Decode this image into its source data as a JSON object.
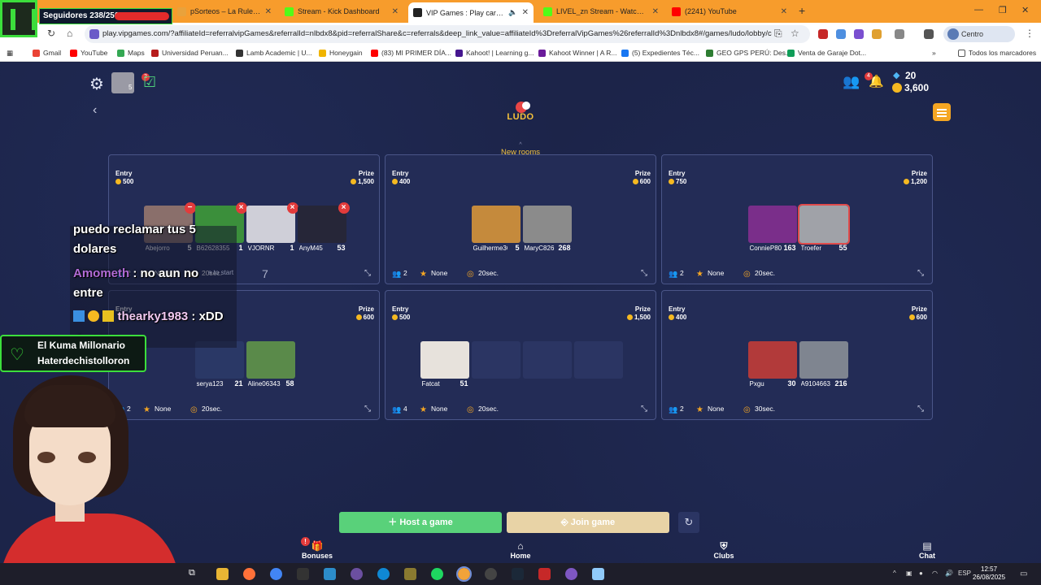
{
  "browser": {
    "tabs": [
      {
        "label": "pSorteos – La Ruleta de la S",
        "favicon_color": "#e9a23b"
      },
      {
        "label": "Stream - Kick Dashboard",
        "favicon_color": "#53fc18"
      },
      {
        "label": "VIP Games : Play card and l",
        "favicon_color": "#222222",
        "active": true
      },
      {
        "label": "LIVEL_zn Stream - Watch Live o",
        "favicon_color": "#53fc18"
      },
      {
        "label": "(2241) YouTube",
        "favicon_color": "#ff0000"
      }
    ],
    "new_tab": "+",
    "url": "play.vipgames.com/?affiliateId=referralvipGames&referralId=nlbdx8&pid=referralShare&c=referrals&deep_link_value=affiliateId%3DreferralVipGames%26referralId%3Dnlbdx8#/games/ludo/lobby/c",
    "profile": "Centro educativo",
    "bookmarks": [
      "Gmail",
      "YouTube",
      "Maps",
      "Universidad Peruan...",
      "Lamb Academic | U...",
      "Honeygain",
      "(83) MI PRIMER DÍA...",
      "Kahoot! | Learning g...",
      "Kahoot Winner | A R...",
      "(5) Expedientes Téc...",
      "GEO GPS PERÚ: Des...",
      "Venta de Garaje Dot..."
    ],
    "bookmarks_other": "Todos los marcadores"
  },
  "app": {
    "header": {
      "notif_badge": "2",
      "avatar_badge": "5",
      "friends_badge": "4",
      "gems": "20",
      "coins": "3,600"
    },
    "logo_text": "LUDO",
    "new_rooms": "New rooms",
    "entry_label": "Entry",
    "prize_label": "Prize",
    "rooms": [
      {
        "entry": "500",
        "prize": "1,500",
        "players_count": "2",
        "mode": "None",
        "time": "20sec.",
        "players": [
          {
            "name": "Abejorro",
            "level": "5",
            "color": "#8a6f6b",
            "kick": "minus"
          },
          {
            "name": "B62628355",
            "level": "1",
            "color": "#3b8f3b",
            "kick": "x"
          },
          {
            "name": "VJORNR",
            "level": "1",
            "color": "#cfcfd8",
            "kick": "x"
          },
          {
            "name": "AnyM45",
            "level": "53",
            "color": "#262638",
            "kick": "x"
          }
        ]
      },
      {
        "entry": "400",
        "prize": "600",
        "players_count": "2",
        "mode": "None",
        "time": "20sec.",
        "players": [
          {
            "name": "Guilherme36",
            "level": "5",
            "color": "#c58a3c"
          },
          {
            "name": "MaryC826",
            "level": "268",
            "color": "#8b8b8b"
          }
        ]
      },
      {
        "entry": "750",
        "prize": "1,200",
        "players_count": "2",
        "mode": "None",
        "time": "20sec.",
        "players": [
          {
            "name": "ConnieP80",
            "level": "163",
            "color": "#7a2e8a"
          },
          {
            "name": "Troefer",
            "level": "55",
            "color": "#a0a2a8",
            "vip": true
          }
        ]
      },
      {
        "entry": "",
        "prize": "600",
        "players_count": "2",
        "mode": "None",
        "time": "20sec.",
        "players": [
          {
            "name": "serya123",
            "level": "21",
            "color": "#2a3866"
          },
          {
            "name": "Aline06343",
            "level": "58",
            "color": "#5a8a4a"
          }
        ]
      },
      {
        "entry": "500",
        "prize": "1,500",
        "players_count": "4",
        "mode": "None",
        "time": "20sec.",
        "players": [
          {
            "name": "Fatcat",
            "level": "51",
            "color": "#e7e2dc"
          },
          {
            "name": "",
            "level": "",
            "empty": true
          },
          {
            "name": "",
            "level": "",
            "empty": true
          },
          {
            "name": "",
            "level": "",
            "empty": true
          }
        ]
      },
      {
        "entry": "400",
        "prize": "600",
        "players_count": "2",
        "mode": "None",
        "time": "30sec.",
        "players": [
          {
            "name": "Pxgu",
            "level": "30",
            "color": "#b23a3a"
          },
          {
            "name": "A9104663",
            "level": "216",
            "color": "#7f8590"
          }
        ]
      }
    ],
    "host_btn": "＋ Host a game",
    "join_btn": "⎆ Join game",
    "nav": [
      {
        "label": "Bonuses",
        "icon": "gift-icon"
      },
      {
        "label": "Home",
        "icon": "home-icon"
      },
      {
        "label": "Clubs",
        "icon": "clubs-icon"
      },
      {
        "label": "Chat",
        "icon": "chat-icon"
      }
    ],
    "bonus_badge": "!"
  },
  "stream": {
    "followers": "Seguidores 238/250",
    "followers_progress": 0.952,
    "chat": [
      {
        "user": "",
        "text": "puedo reclamar tus 5"
      },
      {
        "user": "",
        "text": "dolares"
      },
      {
        "user": "Amometh",
        "text": " : no aun no",
        "user_color": "#b26bd6"
      },
      {
        "user": "",
        "text": "entre"
      },
      {
        "user": "thearky1983",
        "text": " : xDD",
        "user_color": "#f0c8f0"
      },
      {
        "user": "rky1983",
        "text": " :",
        "user_color": "#f0c8f0"
      }
    ],
    "chat_extra_number": "7",
    "ready_text": "e to start",
    "alert_line1": "El Kuma Millonario",
    "alert_line2": "Haterdechistolloron"
  },
  "taskbar": {
    "lang": "ESP",
    "time": "12:57",
    "date": "26/08/2025"
  }
}
